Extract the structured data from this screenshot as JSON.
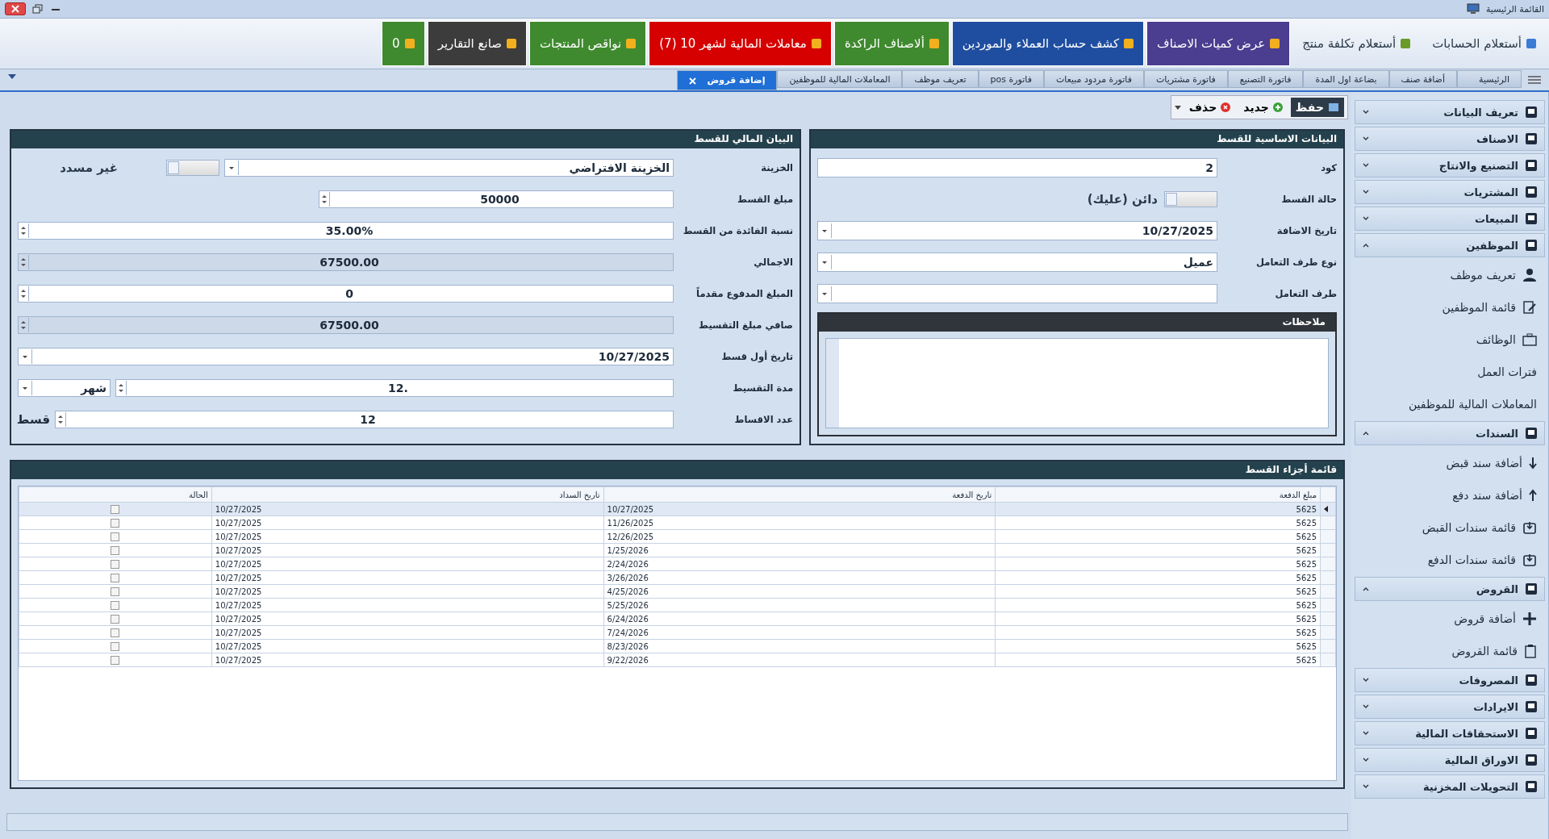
{
  "window": {
    "title": "القائمة الرئيسية"
  },
  "quick_bar": [
    {
      "label": "أستعلام الحسابات",
      "kind": "link"
    },
    {
      "label": "أستعلام تكلفة منتج",
      "kind": "link"
    },
    {
      "label": "عرض كميات الاصناف",
      "kind": "tile",
      "color": "#4b3d8f"
    },
    {
      "label": "كشف حساب العملاء والموردين",
      "kind": "tile",
      "color": "#1f4ea1"
    },
    {
      "label": "ألاصناف الراكدة",
      "kind": "tile",
      "color": "#3f8a2e"
    },
    {
      "label": "معاملات المالية لشهر 10  (7)",
      "kind": "tile",
      "color": "#d60000"
    },
    {
      "label": "نواقص المنتجات",
      "kind": "tile",
      "color": "#3f8a2e"
    },
    {
      "label": "صانع التقارير",
      "kind": "tile",
      "color": "#3c3c3c"
    },
    {
      "label": "0",
      "kind": "tile",
      "color": "#3f8a2e"
    }
  ],
  "tabs": [
    {
      "label": "الرئيسية",
      "selected": false
    },
    {
      "label": "أضافة صنف",
      "selected": false
    },
    {
      "label": "بضاعة اول المدة",
      "selected": false
    },
    {
      "label": "فاتورة التصنيع",
      "selected": false
    },
    {
      "label": "فاتورة مشتريات",
      "selected": false
    },
    {
      "label": "فاتورة مردود مبيعات",
      "selected": false
    },
    {
      "label": "فاتورة pos",
      "selected": false
    },
    {
      "label": "تعريف موظف",
      "selected": false
    },
    {
      "label": "المعاملات المالية للموظفين",
      "selected": false
    },
    {
      "label": "إضافة قروض",
      "selected": true
    }
  ],
  "actions": [
    {
      "label": "حفظ",
      "kind": "save"
    },
    {
      "label": "جديد",
      "kind": "new"
    },
    {
      "label": "حذف",
      "kind": "delete"
    }
  ],
  "basic_panel": {
    "title": "البيانات الاساسية للقسط",
    "fields": [
      {
        "label": "كود",
        "kind": "text",
        "value": "2"
      },
      {
        "label": "حالة القسط",
        "kind": "toggle",
        "on": false,
        "caption": "دائن (عليك)"
      },
      {
        "label": "تاريخ الاضافة",
        "kind": "date",
        "value": "10/27/2025"
      },
      {
        "label": "نوع طرف التعامل",
        "kind": "combo",
        "value": "عميل"
      },
      {
        "label": "طرف التعامل",
        "kind": "combo"
      }
    ],
    "notes": {
      "title": "ملاحظات"
    }
  },
  "financial_panel": {
    "title": "البيان المالي للقسط",
    "fields": [
      {
        "label": "الخزينة",
        "kind": "combo",
        "value": "الخزينة الافتراضي",
        "extra": {
          "kind": "toggle",
          "on": false,
          "caption": "غير مسدد"
        }
      },
      {
        "label": "مبلغ القسط",
        "kind": "spin",
        "value": "50000"
      },
      {
        "label": "نسبة الفائدة من القسط",
        "kind": "spin",
        "value": "35.00%"
      },
      {
        "label": "الاجمالي",
        "kind": "readonly",
        "value": "67500.00"
      },
      {
        "label": "المبلغ المدفوع مقدماً",
        "kind": "spin",
        "value": "0"
      },
      {
        "label": "صافي مبلغ التقسيط",
        "kind": "readonly",
        "value": "67500.00"
      },
      {
        "label": "تاريخ أول قسط",
        "kind": "date",
        "value": "10/27/2025"
      },
      {
        "label": "مدة التقسيط",
        "kind": "spin",
        "value": ".12",
        "extra": {
          "kind": "combo",
          "value": "شهر"
        }
      },
      {
        "label": "عدد الاقساط",
        "kind": "spin",
        "value": "12",
        "extra": {
          "kind": "unit",
          "value": "قسط"
        }
      }
    ]
  },
  "installments": {
    "title": "قائمة أجزاء القسط",
    "columns": [
      "مبلغ الدفعة",
      "تاريخ الدفعة",
      "تاريخ السداد",
      "الحالة"
    ],
    "rows": [
      {
        "amount": "5625",
        "due": "10/27/2025",
        "paid_on": "10/27/2025",
        "checked": false,
        "selected": true
      },
      {
        "amount": "5625",
        "due": "11/26/2025",
        "paid_on": "10/27/2025",
        "checked": false,
        "selected": false
      },
      {
        "amount": "5625",
        "due": "12/26/2025",
        "paid_on": "10/27/2025",
        "checked": false,
        "selected": false
      },
      {
        "amount": "5625",
        "due": "1/25/2026",
        "paid_on": "10/27/2025",
        "checked": false,
        "selected": false
      },
      {
        "amount": "5625",
        "due": "2/24/2026",
        "paid_on": "10/27/2025",
        "checked": false,
        "selected": false
      },
      {
        "amount": "5625",
        "due": "3/26/2026",
        "paid_on": "10/27/2025",
        "checked": false,
        "selected": false
      },
      {
        "amount": "5625",
        "due": "4/25/2026",
        "paid_on": "10/27/2025",
        "checked": false,
        "selected": false
      },
      {
        "amount": "5625",
        "due": "5/25/2026",
        "paid_on": "10/27/2025",
        "checked": false,
        "selected": false
      },
      {
        "amount": "5625",
        "due": "6/24/2026",
        "paid_on": "10/27/2025",
        "checked": false,
        "selected": false
      },
      {
        "amount": "5625",
        "due": "7/24/2026",
        "paid_on": "10/27/2025",
        "checked": false,
        "selected": false
      },
      {
        "amount": "5625",
        "due": "8/23/2026",
        "paid_on": "10/27/2025",
        "checked": false,
        "selected": false
      },
      {
        "amount": "5625",
        "due": "9/22/2026",
        "paid_on": "10/27/2025",
        "checked": false,
        "selected": false
      }
    ]
  },
  "sidebar": [
    {
      "label": "تعريف البيانات",
      "expanded": false
    },
    {
      "label": "الاصناف",
      "expanded": false
    },
    {
      "label": "التصنيع والانتاج",
      "expanded": false
    },
    {
      "label": "المشتريات",
      "expanded": false
    },
    {
      "label": "المبيعات",
      "expanded": false
    },
    {
      "label": "الموظفين",
      "expanded": true,
      "children": [
        {
          "label": "تعريف موظف"
        },
        {
          "label": "قائمة الموظفين"
        },
        {
          "label": "الوظائف"
        },
        {
          "label": "فترات العمل"
        },
        {
          "label": "المعاملات المالية للموظفين"
        }
      ]
    },
    {
      "label": "السندات",
      "expanded": true,
      "children": [
        {
          "label": "أضافة سند قبض"
        },
        {
          "label": "أضافة سند دفع"
        },
        {
          "label": "قائمة سندات القبض"
        },
        {
          "label": "قائمة سندات الدفع"
        }
      ]
    },
    {
      "label": "القروض",
      "expanded": true,
      "children": [
        {
          "label": "أضافة قروض"
        },
        {
          "label": "قائمة القروض"
        }
      ]
    },
    {
      "label": "المصروفات",
      "expanded": false
    },
    {
      "label": "الايرادات",
      "expanded": false
    },
    {
      "label": "الاستحقاقات المالية",
      "expanded": false
    },
    {
      "label": "الاوراق المالية",
      "expanded": false
    },
    {
      "label": "التحويلات المخزنية",
      "expanded": false
    }
  ]
}
